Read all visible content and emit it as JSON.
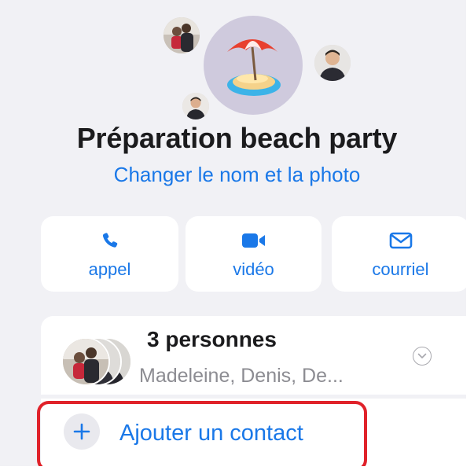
{
  "conversation": {
    "title": "Préparation beach party",
    "edit_link": "Changer le nom et la photo",
    "group_photo_icon": "beach-umbrella-island-icon"
  },
  "actions": [
    {
      "label": "appel",
      "icon": "phone-icon"
    },
    {
      "label": "vidéo",
      "icon": "video-camera-icon"
    },
    {
      "label": "courriel",
      "icon": "envelope-icon"
    }
  ],
  "members": {
    "count_label": "3 personnes",
    "names": "Madeleine, Denis, De...",
    "expand_icon": "chevron-down-icon"
  },
  "add_contact": {
    "label": "Ajouter un contact",
    "icon": "plus-icon"
  },
  "colors": {
    "accent": "#1a78e8",
    "background": "#f1f1f5",
    "card": "#ffffff",
    "highlight": "#e0222a"
  }
}
